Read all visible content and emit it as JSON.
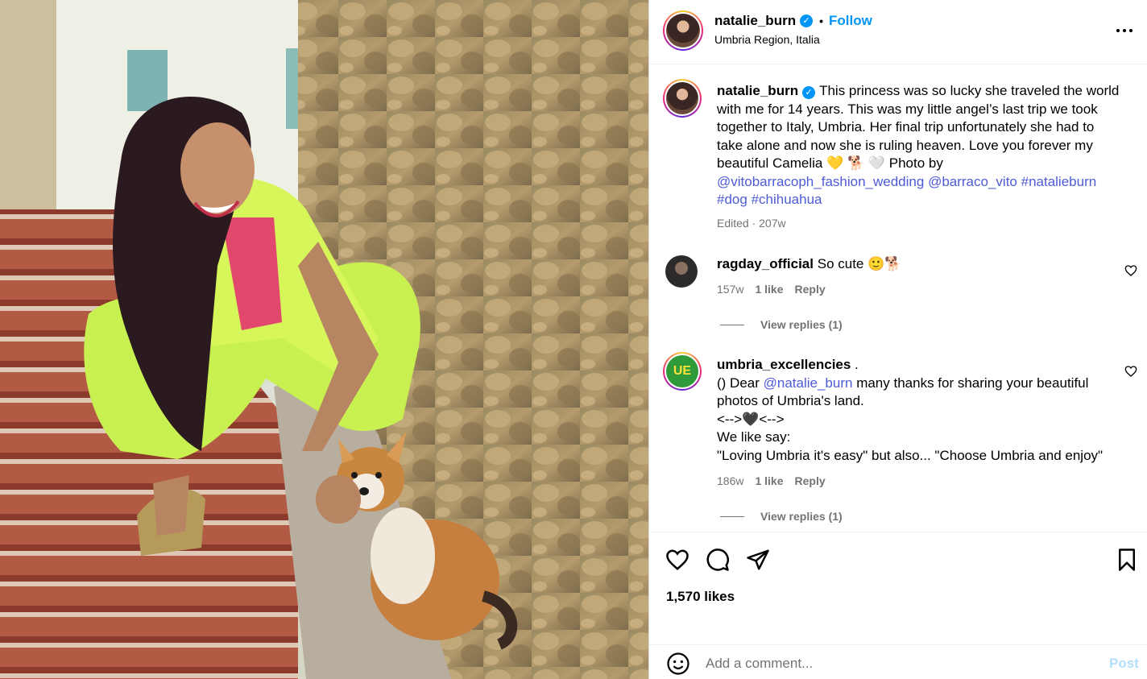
{
  "header": {
    "username": "natalie_burn",
    "follow_label": "Follow",
    "location": "Umbria Region, Italia",
    "more_label": "•••"
  },
  "caption": {
    "username": "natalie_burn",
    "text": "This princess was so lucky she traveled the world with me for 14 years. This was my little angel’s last trip we took together to Italy, Umbria. Her final trip unfortunately she had to take alone and now she is ruling heaven. Love you forever my beautiful Camelia 💛 🐕 🤍 Photo by",
    "tags": [
      "@vitobarracoph_fashion_wedding",
      "@barraco_vito",
      "#natalieburn",
      "#dog",
      "#chihuahua"
    ],
    "meta": "Edited · 207w"
  },
  "comments": [
    {
      "username": "ragday_official",
      "text": "So cute 🙂🐕",
      "age": "157w",
      "likes": "1 like",
      "reply_label": "Reply",
      "view_replies": "View replies (1)"
    },
    {
      "username": "umbria_excellencies",
      "username_suffix": " .",
      "line1_prefix": "() Dear ",
      "mention": "@natalie_burn",
      "line1_suffix": " many thanks for sharing your beautiful photos of Umbria's land.",
      "line2": "<-->🖤<-->",
      "line3": "We like say:",
      "line4": "\"Loving Umbria it's easy\" but also... \"Choose Umbria and enjoy\"",
      "age": "186w",
      "likes": "1 like",
      "reply_label": "Reply",
      "view_replies": "View replies (1)",
      "avatar_text": "UE"
    }
  ],
  "post": {
    "likes": "1,570 likes"
  },
  "add_comment": {
    "placeholder": "Add a comment...",
    "post_label": "Post"
  },
  "colors": {
    "link": "#4d5bd6",
    "follow": "#0095f6",
    "meta": "#737373",
    "post_disabled": "#b2dffc"
  },
  "icons": {
    "like": "heart-icon",
    "comment": "comment-icon",
    "share": "paper-plane-icon",
    "save": "bookmark-icon",
    "emoji": "smiley-icon",
    "more": "more-options-icon",
    "verified": "verified-badge-icon"
  }
}
